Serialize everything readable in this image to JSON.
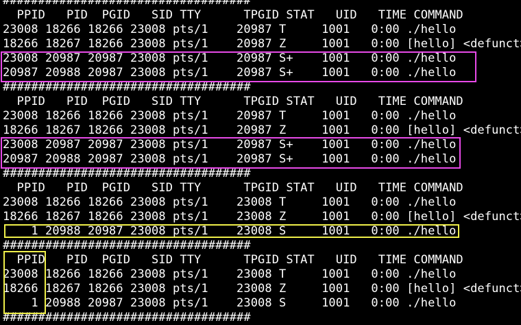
{
  "colors": {
    "background": "#000000",
    "text": "#ffffff",
    "magenta_highlight": "#e84ae8",
    "yellow_highlight": "#f0f04a"
  },
  "terminal": {
    "lines": [
      "###################################",
      "  PPID   PID  PGID   SID TTY      TPGID STAT   UID   TIME COMMAND",
      "23008 18266 18266 23008 pts/1    20987 T     1001   0:00 ./hello",
      "18266 18267 18266 23008 pts/1    20987 Z     1001   0:00 [hello] <defunct>",
      "23008 20987 20987 23008 pts/1    20987 S+    1001   0:00 ./hello",
      "20987 20988 20987 23008 pts/1    20987 S+    1001   0:00 ./hello",
      "###################################",
      "  PPID   PID  PGID   SID TTY      TPGID STAT   UID   TIME COMMAND",
      "23008 18266 18266 23008 pts/1    20987 T     1001   0:00 ./hello",
      "18266 18267 18266 23008 pts/1    20987 Z     1001   0:00 [hello] <defunct>",
      "23008 20987 20987 23008 pts/1    20987 S+    1001   0:00 ./hello",
      "20987 20988 20987 23008 pts/1    20987 S+    1001   0:00 ./hello",
      "###################################",
      "  PPID   PID  PGID   SID TTY      TPGID STAT   UID   TIME COMMAND",
      "23008 18266 18266 23008 pts/1    23008 T     1001   0:00 ./hello",
      "18266 18267 18266 23008 pts/1    23008 Z     1001   0:00 [hello] <defunct>",
      "    1 20988 20987 23008 pts/1    23008 S     1001   0:00 ./hello",
      "###################################",
      "  PPID   PID  PGID   SID TTY      TPGID STAT   UID   TIME COMMAND",
      "23008 18266 18266 23008 pts/1    23008 T     1001   0:00 ./hello",
      "18266 18267 18266 23008 pts/1    23008 Z     1001   0:00 [hello] <defunct>",
      "    1 20988 20987 23008 pts/1    23008 S     1001   0:00 ./hello",
      "###################################"
    ]
  }
}
